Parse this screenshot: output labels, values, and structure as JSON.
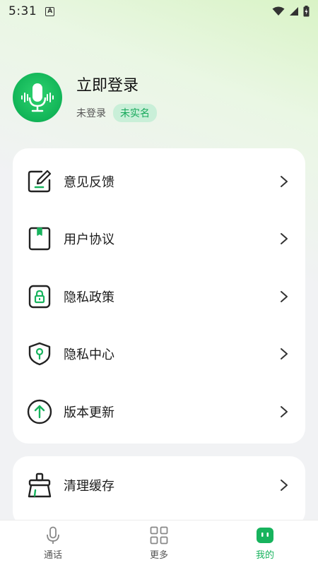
{
  "status_bar": {
    "time": "5:31",
    "notification_badge": "A"
  },
  "profile": {
    "title": "立即登录",
    "status": "未登录",
    "badge": "未实名"
  },
  "menu": {
    "items": [
      {
        "label": "意见反馈",
        "icon": "feedback-edit-icon"
      },
      {
        "label": "用户协议",
        "icon": "user-agreement-book-icon"
      },
      {
        "label": "隐私政策",
        "icon": "privacy-lock-icon"
      },
      {
        "label": "隐私中心",
        "icon": "privacy-shield-icon"
      },
      {
        "label": "版本更新",
        "icon": "update-arrow-icon"
      }
    ],
    "secondary_items": [
      {
        "label": "清理缓存",
        "icon": "broom-clean-icon"
      }
    ]
  },
  "tabbar": {
    "tabs": [
      {
        "label": "通话",
        "icon": "microphone-icon",
        "active": false
      },
      {
        "label": "更多",
        "icon": "grid-icon",
        "active": false
      },
      {
        "label": "我的",
        "icon": "robot-face-icon",
        "active": true
      }
    ]
  },
  "colors": {
    "accent": "#17b35d",
    "badge_bg": "#c9efd8"
  }
}
